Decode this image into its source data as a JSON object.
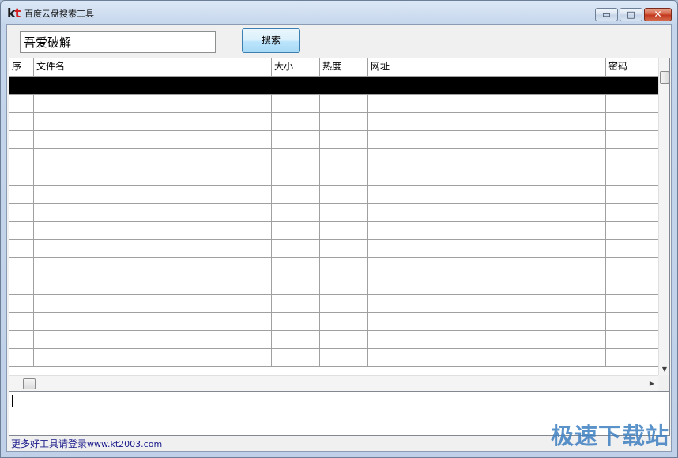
{
  "window": {
    "logo": {
      "k": "k",
      "t": "t"
    },
    "title": "百度云盘搜索工具",
    "controls": {
      "minimize": "▭",
      "maximize": "□",
      "close": "✕"
    }
  },
  "search": {
    "value": "吾爱破解",
    "button_label": "搜索"
  },
  "table": {
    "columns": [
      {
        "label": "序"
      },
      {
        "label": "文件名"
      },
      {
        "label": "大小"
      },
      {
        "label": "热度"
      },
      {
        "label": "网址"
      },
      {
        "label": "密码"
      }
    ],
    "row_count": 16,
    "selected_row": 1
  },
  "status": {
    "text": "更多好工具请登录",
    "url": "www.kt2003.com"
  },
  "watermark": "极速下载站",
  "colors": {
    "selection": "#000000",
    "link": "#1a1a8c",
    "watermark": "#3e7fc1"
  }
}
